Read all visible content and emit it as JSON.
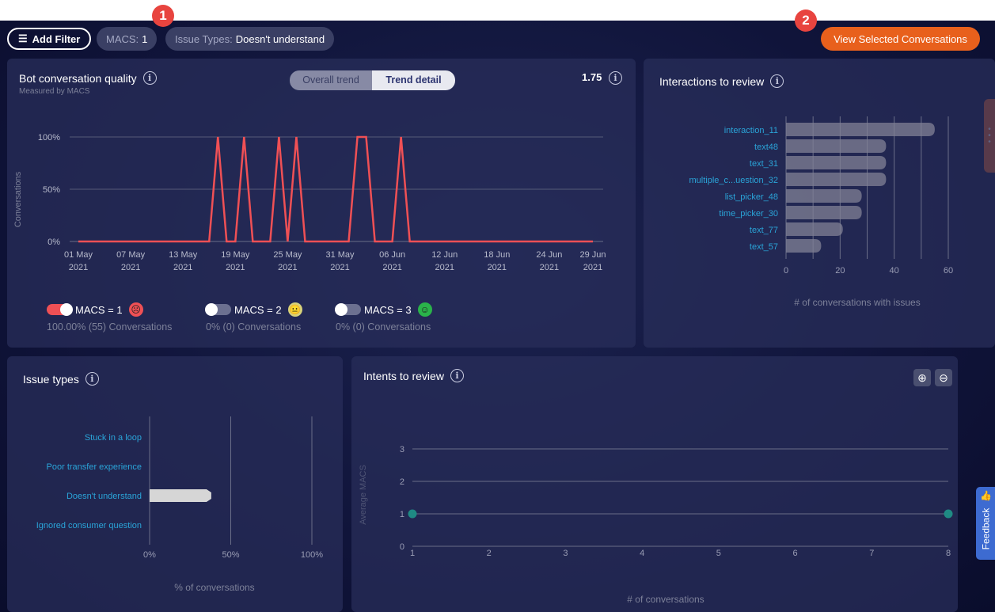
{
  "filters": {
    "add_filter": "Add Filter",
    "chips": [
      {
        "key": "MACS:",
        "value": "1"
      },
      {
        "key": "Issue Types:",
        "value": "Doesn't understand"
      }
    ]
  },
  "badges": [
    "1",
    "2"
  ],
  "view_button": "View Selected Conversations",
  "colors": {
    "accent": "#e8601c",
    "line": "#ef5055",
    "bar": "#6b6c84",
    "issue_bar": "#d6d6d6",
    "link": "#2aa4d8",
    "dot": "#1f8a84",
    "feedback": "#3d6bd1"
  },
  "quality": {
    "title": "Bot conversation quality",
    "subtitle": "Measured by MACS",
    "tabs": [
      "Overall trend",
      "Trend detail"
    ],
    "active_tab": 1,
    "score": "1.75",
    "legend": [
      {
        "label": "MACS = 1",
        "sub": "100.00% (55) Conversations",
        "on": true,
        "face": "frown-icon",
        "color": "#ef5055"
      },
      {
        "label": "MACS = 2",
        "sub": "0% (0) Conversations",
        "on": false,
        "face": "neutral-icon",
        "color": "#d8d27a"
      },
      {
        "label": "MACS = 3",
        "sub": "0% (0) Conversations",
        "on": false,
        "face": "smile-icon",
        "color": "#2ab34a"
      }
    ]
  },
  "interactions": {
    "title": "Interactions to review"
  },
  "issues": {
    "title": "Issue types"
  },
  "intents": {
    "title": "Intents to review"
  },
  "feedback": "Feedback",
  "chart_data": [
    {
      "type": "line",
      "ylabel": "Conversations",
      "yticks": [
        "0%",
        "50%",
        "100%"
      ],
      "ylim": [
        0,
        100
      ],
      "x_range": [
        "01 May 2021",
        "29 Jun 2021"
      ],
      "x_step": "1 day",
      "xticks": [
        [
          "01 May",
          "2021"
        ],
        [
          "07 May",
          "2021"
        ],
        [
          "13 May",
          "2021"
        ],
        [
          "19 May",
          "2021"
        ],
        [
          "25 May",
          "2021"
        ],
        [
          "31 May",
          "2021"
        ],
        [
          "06 Jun",
          "2021"
        ],
        [
          "12 Jun",
          "2021"
        ],
        [
          "18 Jun",
          "2021"
        ],
        [
          "24 Jun",
          "2021"
        ],
        [
          "29 Jun",
          "2021"
        ]
      ],
      "xtick_days": [
        0,
        6,
        12,
        18,
        24,
        30,
        36,
        42,
        48,
        54,
        59
      ],
      "series": [
        {
          "name": "MACS = 1",
          "values": [
            0,
            0,
            0,
            0,
            0,
            0,
            0,
            0,
            0,
            0,
            0,
            0,
            0,
            0,
            0,
            0,
            100,
            0,
            0,
            100,
            0,
            0,
            0,
            100,
            0,
            100,
            0,
            0,
            0,
            0,
            0,
            0,
            100,
            100,
            0,
            0,
            0,
            100,
            0,
            0,
            0,
            0,
            0,
            0,
            0,
            0,
            0,
            0,
            0,
            0,
            0,
            0,
            0,
            0,
            0,
            0,
            0,
            0,
            0,
            0
          ]
        }
      ]
    },
    {
      "type": "bar",
      "orientation": "horizontal",
      "categories": [
        "interaction_11",
        "text48",
        "text_31",
        "multiple_c...uestion_32",
        "list_picker_48",
        "time_picker_30",
        "text_77",
        "text_57"
      ],
      "values": [
        55,
        37,
        37,
        37,
        28,
        28,
        21,
        13
      ],
      "xlim": [
        0,
        60
      ],
      "xticks": [
        "0",
        "20",
        "40",
        "60"
      ],
      "xlabel": "# of conversations with issues",
      "grid": true
    },
    {
      "type": "bar",
      "orientation": "horizontal",
      "categories": [
        "Stuck in a loop",
        "Poor transfer experience",
        "Doesn't understand",
        "Ignored consumer question"
      ],
      "values": [
        0,
        0,
        38,
        0
      ],
      "xlim": [
        0,
        100
      ],
      "xticks": [
        "0%",
        "50%",
        "100%"
      ],
      "xlabel": "% of conversations",
      "grid": true
    },
    {
      "type": "scatter",
      "x": [
        1,
        8
      ],
      "y": [
        1,
        1
      ],
      "xlim": [
        1,
        8
      ],
      "ylim": [
        0,
        3
      ],
      "xticks": [
        "1",
        "2",
        "3",
        "4",
        "5",
        "6",
        "7",
        "8"
      ],
      "yticks": [
        "0",
        "1",
        "2",
        "3"
      ],
      "xlabel": "# of conversations",
      "ylabel": "Average MACS",
      "grid": true
    }
  ]
}
